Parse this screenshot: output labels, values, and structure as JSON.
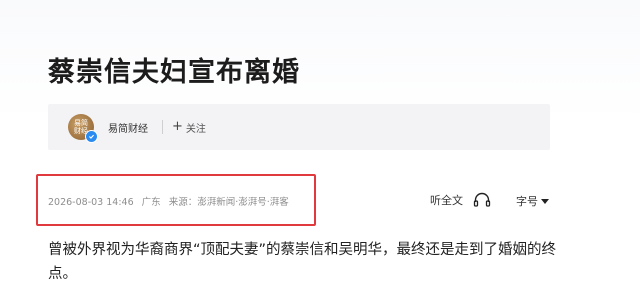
{
  "article": {
    "title": "蔡崇信夫妇宣布离婚",
    "body": "曾被外界视为华裔商界“顶配夫妻”的蔡崇信和吴明华，最终还是走到了婚姻的终点。"
  },
  "author": {
    "avatar_text": "易简财经",
    "name": "易简财经",
    "follow_label": "关注",
    "verified_color": "#2a8cf0"
  },
  "meta": {
    "datetime": "2026-08-03 14:46",
    "location": "广东",
    "source": "来源：澎湃新闻·澎湃号·湃客"
  },
  "toolbar": {
    "listen_label": "听全文",
    "font_size_label": "字号"
  },
  "colors": {
    "highlight_border": "#e0393e",
    "meta_text": "#8e8e8e"
  },
  "icons": {
    "listen": "headphones-icon",
    "font_size": "caret-down-icon",
    "follow": "plus-icon"
  }
}
